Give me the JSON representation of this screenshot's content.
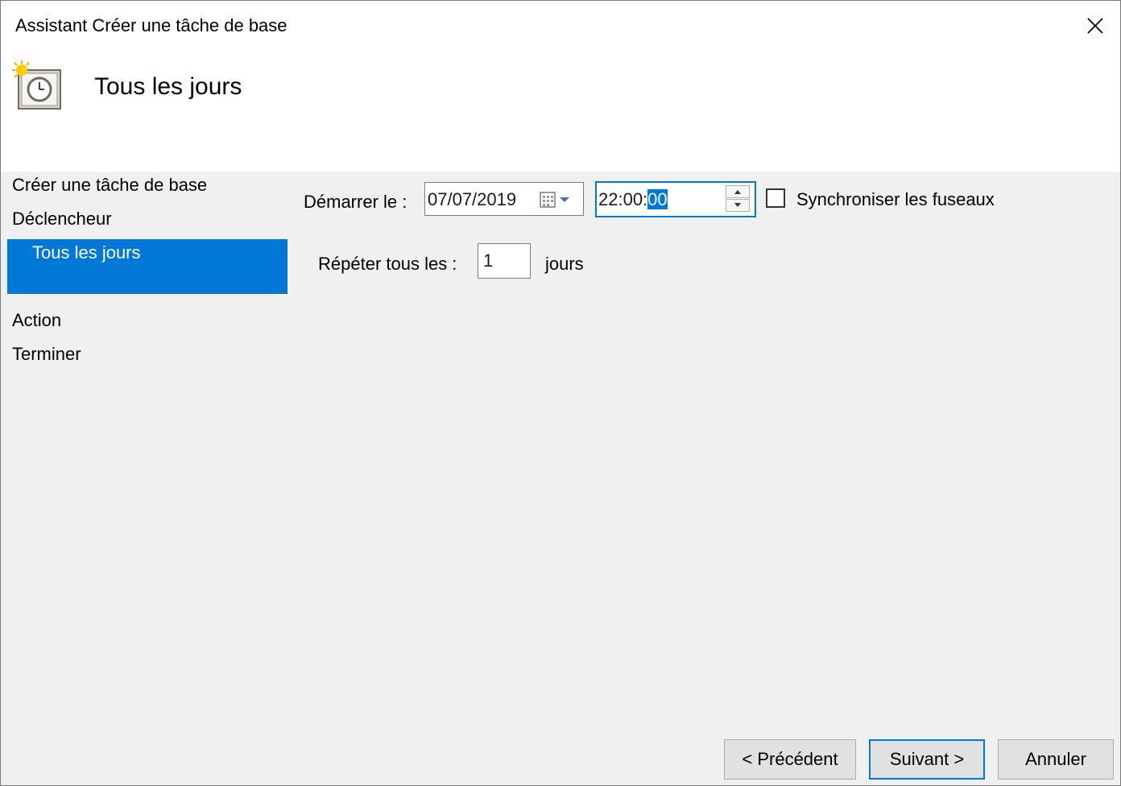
{
  "window": {
    "title": "Assistant Créer une tâche de base",
    "close_glyph": "✕"
  },
  "header": {
    "title": "Tous les jours",
    "icon": "calendar-clock-icon"
  },
  "sidebar": {
    "items": [
      {
        "label": "Créer une tâche de base"
      },
      {
        "label": "Déclencheur"
      },
      {
        "label": "Tous les jours"
      },
      {
        "label": "Action"
      },
      {
        "label": "Terminer"
      }
    ]
  },
  "form": {
    "start_label": "Démarrer le :",
    "start_date": "07/07/2019",
    "start_time_prefix": "22:00:",
    "start_time_selected": "00",
    "sync_label": "Synchroniser les fuseaux",
    "sync_checked": false,
    "repeat_label": "Répéter tous les :",
    "repeat_value": "1",
    "repeat_unit": "jours"
  },
  "buttons": {
    "back": "< Précédent",
    "next": "Suivant >",
    "cancel": "Annuler"
  },
  "colors": {
    "accent": "#0078d7",
    "background": "#f0f0f0"
  }
}
